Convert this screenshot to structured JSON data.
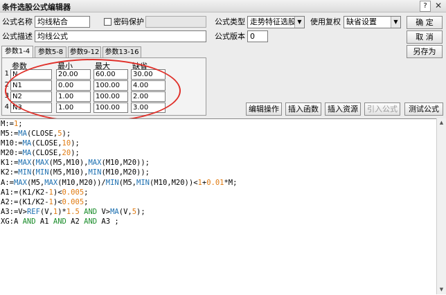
{
  "window": {
    "title": "条件选股公式编辑器",
    "help_label": "?",
    "close_label": "✕"
  },
  "form": {
    "name_label": "公式名称",
    "name_value": "均线粘合",
    "password_label": "密码保护",
    "desc_label": "公式描述",
    "desc_value": "均线公式",
    "type_label": "公式类型",
    "type_value": "走势特征选股",
    "reinstate_label": "使用复权",
    "reinstate_value": "缺省设置",
    "version_label": "公式版本",
    "version_value": "0"
  },
  "buttons": {
    "confirm": "确  定",
    "cancel": "取  消",
    "save_as": "另存为",
    "edit_ops": "编辑操作",
    "insert_func": "插入函数",
    "insert_res": "插入资源",
    "import_formula": "引入公式",
    "test_formula": "测试公式"
  },
  "tabs": [
    "参数1-4",
    "参数5-8",
    "参数9-12",
    "参数13-16"
  ],
  "params": {
    "headers": [
      "参数",
      "最小",
      "最大",
      "缺省"
    ],
    "rows": [
      {
        "num": "1",
        "name": "N",
        "min": "20.00",
        "max": "60.00",
        "def": "30.00"
      },
      {
        "num": "2",
        "name": "N1",
        "min": "0.00",
        "max": "100.00",
        "def": "4.00"
      },
      {
        "num": "3",
        "name": "N2",
        "min": "1.00",
        "max": "100.00",
        "def": "2.00"
      },
      {
        "num": "4",
        "name": "N3",
        "min": "1.00",
        "max": "100.00",
        "def": "3.00"
      }
    ]
  },
  "colors": {
    "keyword": "#1c6fb0",
    "function": "#1c6fb0",
    "number": "#e07a10",
    "logic": "#1a8c2a",
    "text": "#000000",
    "highlight": "#e0302a"
  },
  "code_lines": [
    [
      [
        "M:=",
        "t"
      ],
      [
        "1",
        "n"
      ],
      [
        ";",
        "t"
      ]
    ],
    [
      [
        "M5:=",
        "t"
      ],
      [
        "MA",
        "f"
      ],
      [
        "(CLOSE,",
        "t"
      ],
      [
        "5",
        "n"
      ],
      [
        ");",
        "t"
      ]
    ],
    [
      [
        "M10:=",
        "t"
      ],
      [
        "MA",
        "f"
      ],
      [
        "(CLOSE,",
        "t"
      ],
      [
        "10",
        "n"
      ],
      [
        ");",
        "t"
      ]
    ],
    [
      [
        "M20:=",
        "t"
      ],
      [
        "MA",
        "f"
      ],
      [
        "(CLOSE,",
        "t"
      ],
      [
        "20",
        "n"
      ],
      [
        ");",
        "t"
      ]
    ],
    [
      [
        "K1:=",
        "t"
      ],
      [
        "MAX",
        "f"
      ],
      [
        "(",
        "t"
      ],
      [
        "MAX",
        "f"
      ],
      [
        "(M5,M10),",
        "t"
      ],
      [
        "MAX",
        "f"
      ],
      [
        "(M10,M20));",
        "t"
      ]
    ],
    [
      [
        "K2:=",
        "t"
      ],
      [
        "MIN",
        "f"
      ],
      [
        "(",
        "t"
      ],
      [
        "MIN",
        "f"
      ],
      [
        "(M5,M10),",
        "t"
      ],
      [
        "MIN",
        "f"
      ],
      [
        "(M10,M20));",
        "t"
      ]
    ],
    [
      [
        "A:=",
        "t"
      ],
      [
        "MAX",
        "f"
      ],
      [
        "(M5,",
        "t"
      ],
      [
        "MAX",
        "f"
      ],
      [
        "(M10,M20))/",
        "t"
      ],
      [
        "MIN",
        "f"
      ],
      [
        "(M5,",
        "t"
      ],
      [
        "MIN",
        "f"
      ],
      [
        "(M10,M20))<",
        "t"
      ],
      [
        "1",
        "n"
      ],
      [
        "+",
        "t"
      ],
      [
        "0.01",
        "n"
      ],
      [
        "*M;",
        "t"
      ]
    ],
    [
      [
        "A1:=(K1/K2-",
        "t"
      ],
      [
        "1",
        "n"
      ],
      [
        ")<",
        "t"
      ],
      [
        "0.005",
        "n"
      ],
      [
        ";",
        "t"
      ]
    ],
    [
      [
        "A2:=(K1/K2-",
        "t"
      ],
      [
        "1",
        "n"
      ],
      [
        ")<",
        "t"
      ],
      [
        "0.005",
        "n"
      ],
      [
        ";",
        "t"
      ]
    ],
    [
      [
        "A3:=V>",
        "t"
      ],
      [
        "REF",
        "f"
      ],
      [
        "(V,",
        "t"
      ],
      [
        "1",
        "n"
      ],
      [
        ")*",
        "t"
      ],
      [
        "1.5",
        "n"
      ],
      [
        " ",
        "t"
      ],
      [
        "AND",
        "l"
      ],
      [
        " V>",
        "t"
      ],
      [
        "MA",
        "f"
      ],
      [
        "(V,",
        "t"
      ],
      [
        "5",
        "n"
      ],
      [
        ");",
        "t"
      ]
    ],
    [
      [
        "XG:A ",
        "t"
      ],
      [
        "AND",
        "l"
      ],
      [
        " A1 ",
        "t"
      ],
      [
        "AND",
        "l"
      ],
      [
        " A2 ",
        "t"
      ],
      [
        "AND",
        "l"
      ],
      [
        " A3 ;",
        "t"
      ]
    ]
  ]
}
